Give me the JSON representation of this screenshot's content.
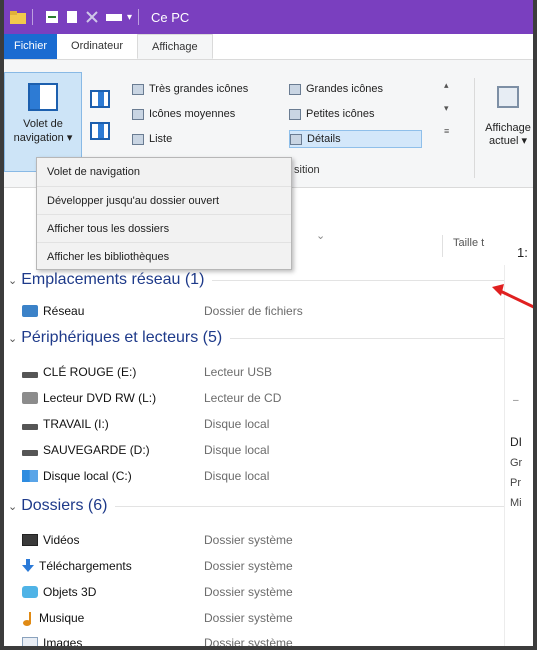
{
  "window": {
    "title": "Ce PC"
  },
  "tabs": [
    "Fichier",
    "Ordinateur",
    "Affichage"
  ],
  "ribbon": {
    "nav_pane_label_1": "Volet de",
    "nav_pane_label_2": "navigation ▾",
    "layouts": {
      "very_large": "Très grandes icônes",
      "large": "Grandes icônes",
      "medium": "Icônes moyennes",
      "small": "Petites icônes",
      "list": "Liste",
      "details": "Détails"
    },
    "current_view_1": "Affichage",
    "current_view_2": "actuel ▾",
    "partial_label": "sition"
  },
  "nav_menu": [
    "Volet de navigation",
    "Développer jusqu'au dossier ouvert",
    "Afficher tous les dossiers",
    "Afficher les bibliothèques"
  ],
  "list_header": {
    "size": "Taille t",
    "right_num": "1:"
  },
  "groups": {
    "network": {
      "title": "Emplacements réseau (1)",
      "items": [
        {
          "name": "Réseau",
          "type": "Dossier de fichiers"
        }
      ]
    },
    "devices": {
      "title": "Périphériques et lecteurs (5)",
      "items": [
        {
          "name": "CLÉ ROUGE (E:)",
          "type": "Lecteur USB"
        },
        {
          "name": "Lecteur DVD RW (L:)",
          "type": "Lecteur de CD"
        },
        {
          "name": "TRAVAIL (I:)",
          "type": "Disque local"
        },
        {
          "name": "SAUVEGARDE (D:)",
          "type": "Disque local"
        },
        {
          "name": "Disque local (C:)",
          "type": "Disque local"
        }
      ]
    },
    "folders": {
      "title": "Dossiers (6)",
      "items": [
        {
          "name": "Vidéos",
          "type": "Dossier système"
        },
        {
          "name": "Téléchargements",
          "type": "Dossier système"
        },
        {
          "name": "Objets 3D",
          "type": "Dossier système"
        },
        {
          "name": "Musique",
          "type": "Dossier système"
        },
        {
          "name": "Images",
          "type": "Dossier système"
        }
      ]
    }
  },
  "details_panel": {
    "d1": "DI",
    "d2": "Gr",
    "d3": "Pr",
    "d4": "Mi"
  },
  "colors": {
    "titlebar": "#7a3fbf",
    "file_tab": "#1a6bd1",
    "group_title": "#1e3a8a",
    "arrow": "#e02020"
  }
}
